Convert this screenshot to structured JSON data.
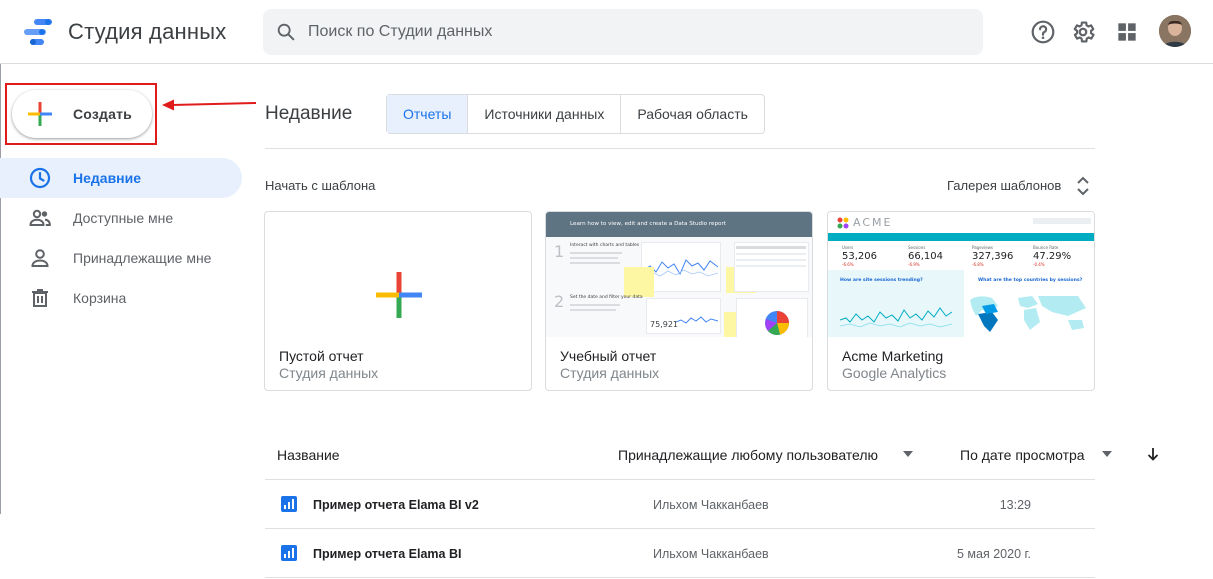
{
  "header": {
    "app_title": "Студия данных",
    "search_placeholder": "Поиск по Студии данных",
    "icons": [
      "help-icon",
      "settings-icon",
      "apps-grid-icon",
      "account-avatar"
    ]
  },
  "sidebar": {
    "create_label": "Создать",
    "items": [
      {
        "label": "Недавние",
        "icon": "clock-icon",
        "active": true
      },
      {
        "label": "Доступные мне",
        "icon": "people-icon",
        "active": false
      },
      {
        "label": "Принадлежащие мне",
        "icon": "person-icon",
        "active": false
      },
      {
        "label": "Корзина",
        "icon": "trash-icon",
        "active": false
      }
    ]
  },
  "main": {
    "title": "Недавние",
    "tabs": [
      {
        "label": "Отчеты",
        "active": true
      },
      {
        "label": "Источники данных",
        "active": false
      },
      {
        "label": "Рабочая область",
        "active": false
      }
    ],
    "templates_label": "Начать с шаблона",
    "gallery_label": "Галерея шаблонов",
    "templates": [
      {
        "title": "Пустой отчет",
        "subtitle": "Студия данных"
      },
      {
        "title": "Учебный отчет",
        "subtitle": "Студия данных"
      },
      {
        "title": "Acme Marketing",
        "subtitle": "Google Analytics"
      }
    ],
    "tutorial_thumb": {
      "banner": "Learn how to view, edit and create a Data Studio report",
      "step1": "Interact with charts and tables",
      "step2": "Set the date and filter your data",
      "metric": "75,921"
    },
    "acme_thumb": {
      "brand": "ACME",
      "kpis": [
        {
          "label": "Users",
          "value": "53,206",
          "delta": "-6.6%"
        },
        {
          "label": "Sessions",
          "value": "66,104",
          "delta": "-6.9%"
        },
        {
          "label": "Pageviews",
          "value": "327,396",
          "delta": "-6.8%"
        },
        {
          "label": "Bounce Rate",
          "value": "47.29%",
          "delta": "-0.4%"
        }
      ],
      "q1": "How are site sessions trending?",
      "q2": "What are the top countries by sessions?"
    },
    "table": {
      "headers": {
        "name": "Название",
        "owner": "Принадлежащие любому пользователю",
        "date": "По дате просмотра"
      },
      "rows": [
        {
          "name": "Пример отчета Elama BI v2",
          "owner": "Ильхом Чакканбаев",
          "date": "13:29"
        },
        {
          "name": "Пример отчета Elama BI",
          "owner": "Ильхом Чакканбаев",
          "date": "5 мая 2020 г."
        }
      ]
    }
  },
  "colors": {
    "accent": "#1a73e8",
    "annotation_red": "#e01b1b",
    "plus_blue": "#4285f4",
    "plus_red": "#ea4335",
    "plus_yellow": "#fbbc04",
    "plus_green": "#34a853"
  }
}
